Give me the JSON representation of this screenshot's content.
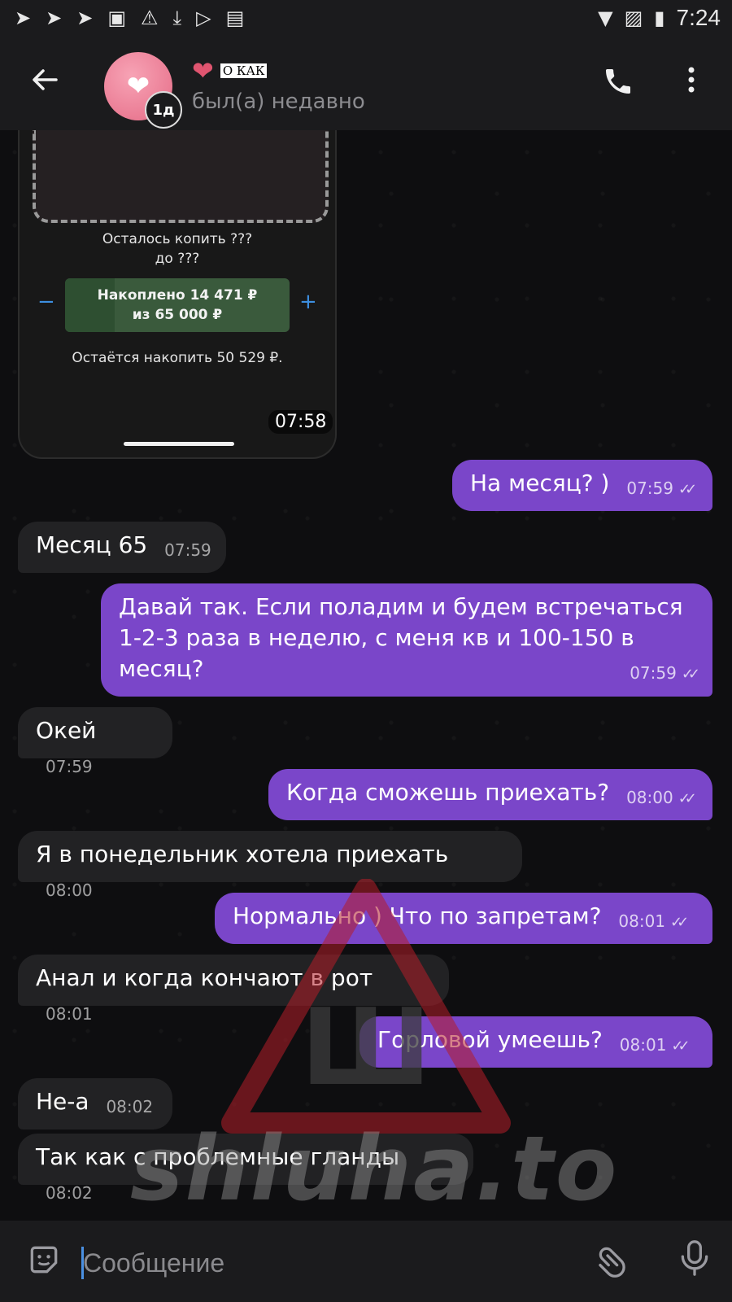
{
  "status_bar": {
    "time": "7:24",
    "left_icons": [
      "telegram-icon",
      "telegram-icon",
      "telegram-icon",
      "gallery-icon",
      "warning-icon",
      "download-icon",
      "play-store-icon",
      "translate-icon"
    ],
    "right_icons": [
      "wifi-icon",
      "no-sim-icon",
      "battery-charging-icon"
    ]
  },
  "header": {
    "contact_name": "О КАК",
    "contact_emoji": "❤",
    "story_badge": "1д",
    "status": "был(а) недавно"
  },
  "shared_image": {
    "text_line1": "Осталось копить ???",
    "text_line2": "до ???",
    "saved_line1": "Накоплено 14 471 ₽",
    "saved_line2": "из 65 000 ₽",
    "saved_progress": 0.22,
    "minus": "−",
    "plus": "+",
    "remaining": "Остаётся накопить 50 529 ₽.",
    "time": "07:58"
  },
  "messages": [
    {
      "dir": "out",
      "text": "На месяц? )",
      "time": "07:59"
    },
    {
      "dir": "in",
      "text": "Месяц 65",
      "time": "07:59"
    },
    {
      "dir": "out",
      "text": "Давай так. Если поладим и будем встречаться 1-2-3 раза в неделю, с меня кв и 100-150 в месяц?",
      "time": "07:59"
    },
    {
      "dir": "in",
      "text": "Окей",
      "time": "07:59"
    },
    {
      "dir": "out",
      "text": "Когда сможешь приехать?",
      "time": "08:00"
    },
    {
      "dir": "in",
      "text": "Я в понедельник хотела приехать",
      "time": "08:00"
    },
    {
      "dir": "out",
      "text": "Нормально ) Что по запретам?",
      "time": "08:01"
    },
    {
      "dir": "in",
      "text": "Анал и когда кончают в рот",
      "time": "08:01"
    },
    {
      "dir": "out",
      "text": "Горловой умеешь?",
      "time": "08:01"
    },
    {
      "dir": "in",
      "text": "Не-а",
      "time": "08:02"
    },
    {
      "dir": "in",
      "text": "Так как с проблемные гланды",
      "time": "08:02"
    }
  ],
  "watermark": {
    "text": "shluha.to",
    "logo_letter": "Ш"
  },
  "input": {
    "placeholder": "Сообщение"
  },
  "colors": {
    "outgoing": "#7a46c9",
    "incoming": "#222224",
    "accent": "#4a90e2"
  }
}
